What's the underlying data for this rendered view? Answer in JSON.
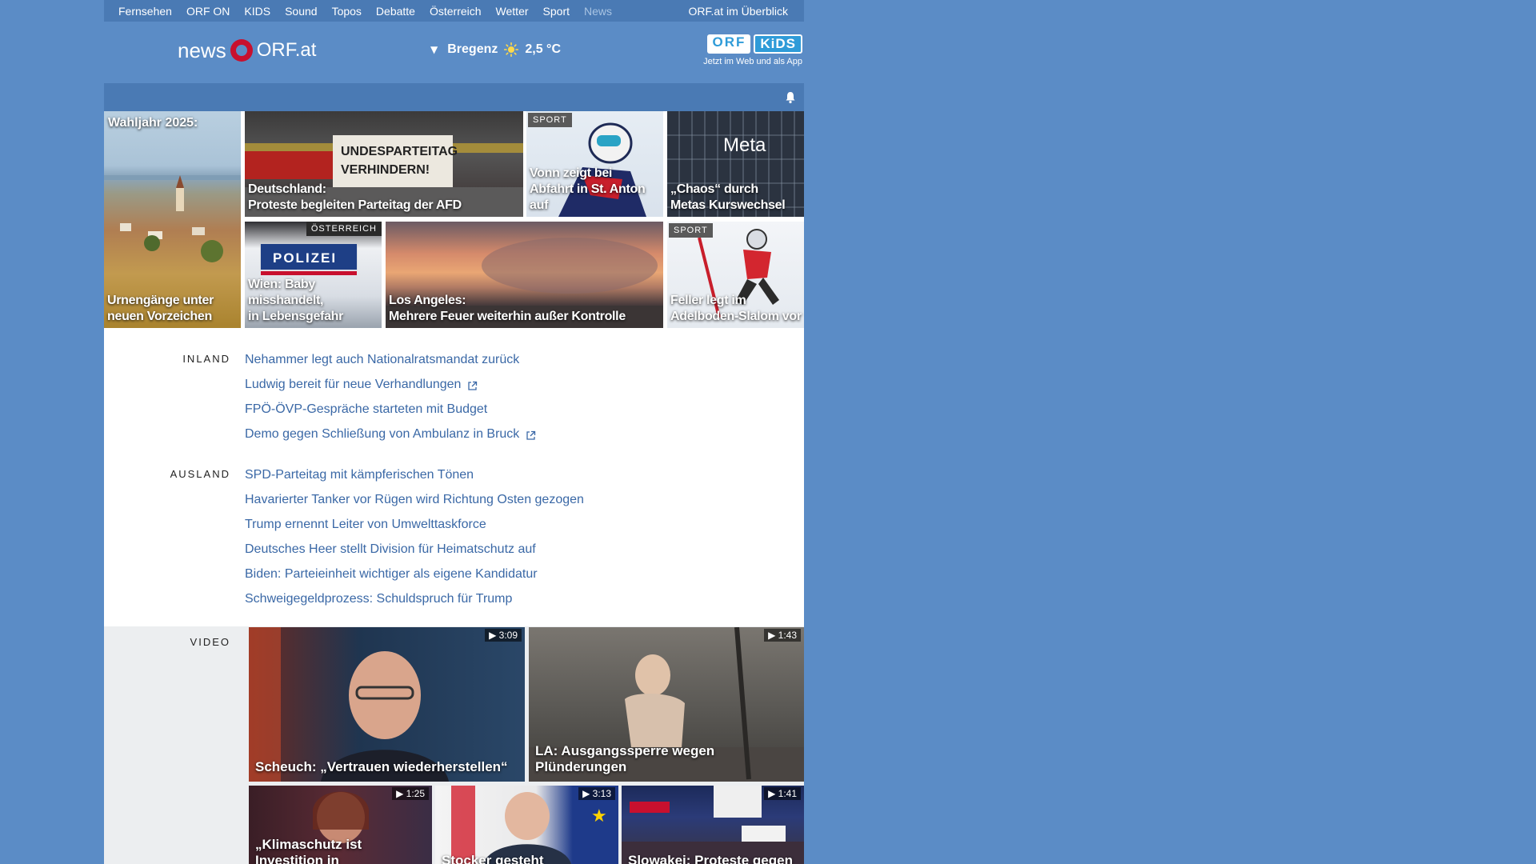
{
  "topnav": [
    "Fernsehen",
    "ORF ON",
    "KIDS",
    "Sound",
    "Topos",
    "Debatte",
    "Österreich",
    "Wetter",
    "Sport",
    "News"
  ],
  "topnav_overview": "ORF.at im Überblick",
  "logo": {
    "news": "news",
    "orf": "ORF.at"
  },
  "weather": {
    "city": "Bregenz",
    "temp": "2,5 °C"
  },
  "kids": {
    "orf": "ORF",
    "kids": "KiDS",
    "tagline": "Jetzt im Web und als App"
  },
  "teasers": {
    "wahljahr": {
      "title": "Wahljahr 2025:",
      "caption1": "Urnengänge unter",
      "caption2": "neuen Vorzeichen"
    },
    "afd": {
      "caption1": "Deutschland:",
      "caption2": "Proteste begleiten Parteitag der AFD"
    },
    "vonn": {
      "tag": "SPORT",
      "caption1": "Vonn zeigt bei",
      "caption2": "Abfahrt in St. Anton auf"
    },
    "meta": {
      "caption1": "„Chaos“ durch",
      "caption2": "Metas Kurswechsel"
    },
    "wien": {
      "tag": "ÖSTERREICH",
      "caption1": "Wien: Baby misshandelt,",
      "caption2": "in Lebensgefahr"
    },
    "la": {
      "caption1": "Los Angeles:",
      "caption2": "Mehrere Feuer weiterhin außer Kontrolle"
    },
    "feller": {
      "tag": "SPORT",
      "caption1": "Feller legt im",
      "caption2": "Adelboden-Slalom vor"
    }
  },
  "inland": {
    "label": "INLAND",
    "items": [
      "Nehammer legt auch Nationalratsmandat zurück",
      "Ludwig bereit für neue Verhandlungen",
      "FPÖ-ÖVP-Gespräche starteten mit Budget",
      "Demo gegen Schließung von Ambulanz in Bruck"
    ]
  },
  "ausland": {
    "label": "AUSLAND",
    "items": [
      "SPD-Parteitag mit kämpferischen Tönen",
      "Havarierter Tanker vor Rügen wird Richtung Osten gezogen",
      "Trump ernennt Leiter von Umwelttaskforce",
      "Deutsches Heer stellt Division für Heimatschutz auf",
      "Biden: Parteieinheit wichtiger als eigene Kandidatur",
      "Schweigegeldprozess: Schuldspruch für Trump"
    ]
  },
  "video": {
    "label": "VIDEO",
    "items": [
      {
        "dur": "▶ 3:09",
        "caption": "Scheuch: „Vertrauen wiederherstellen“"
      },
      {
        "dur": "▶ 1:43",
        "caption": "LA: Ausgangssperre wegen Plünderungen"
      },
      {
        "dur": "▶ 1:25",
        "caption": "„Klimaschutz ist Investition in"
      },
      {
        "dur": "▶ 3:13",
        "caption": "Stocker gesteht"
      },
      {
        "dur": "▶ 1:41",
        "caption": "Slowakei: Proteste gegen"
      }
    ]
  },
  "colors": {
    "page_bg": "#5b8cc6",
    "link": "#3a68a6",
    "orf_red": "#c8102e"
  }
}
